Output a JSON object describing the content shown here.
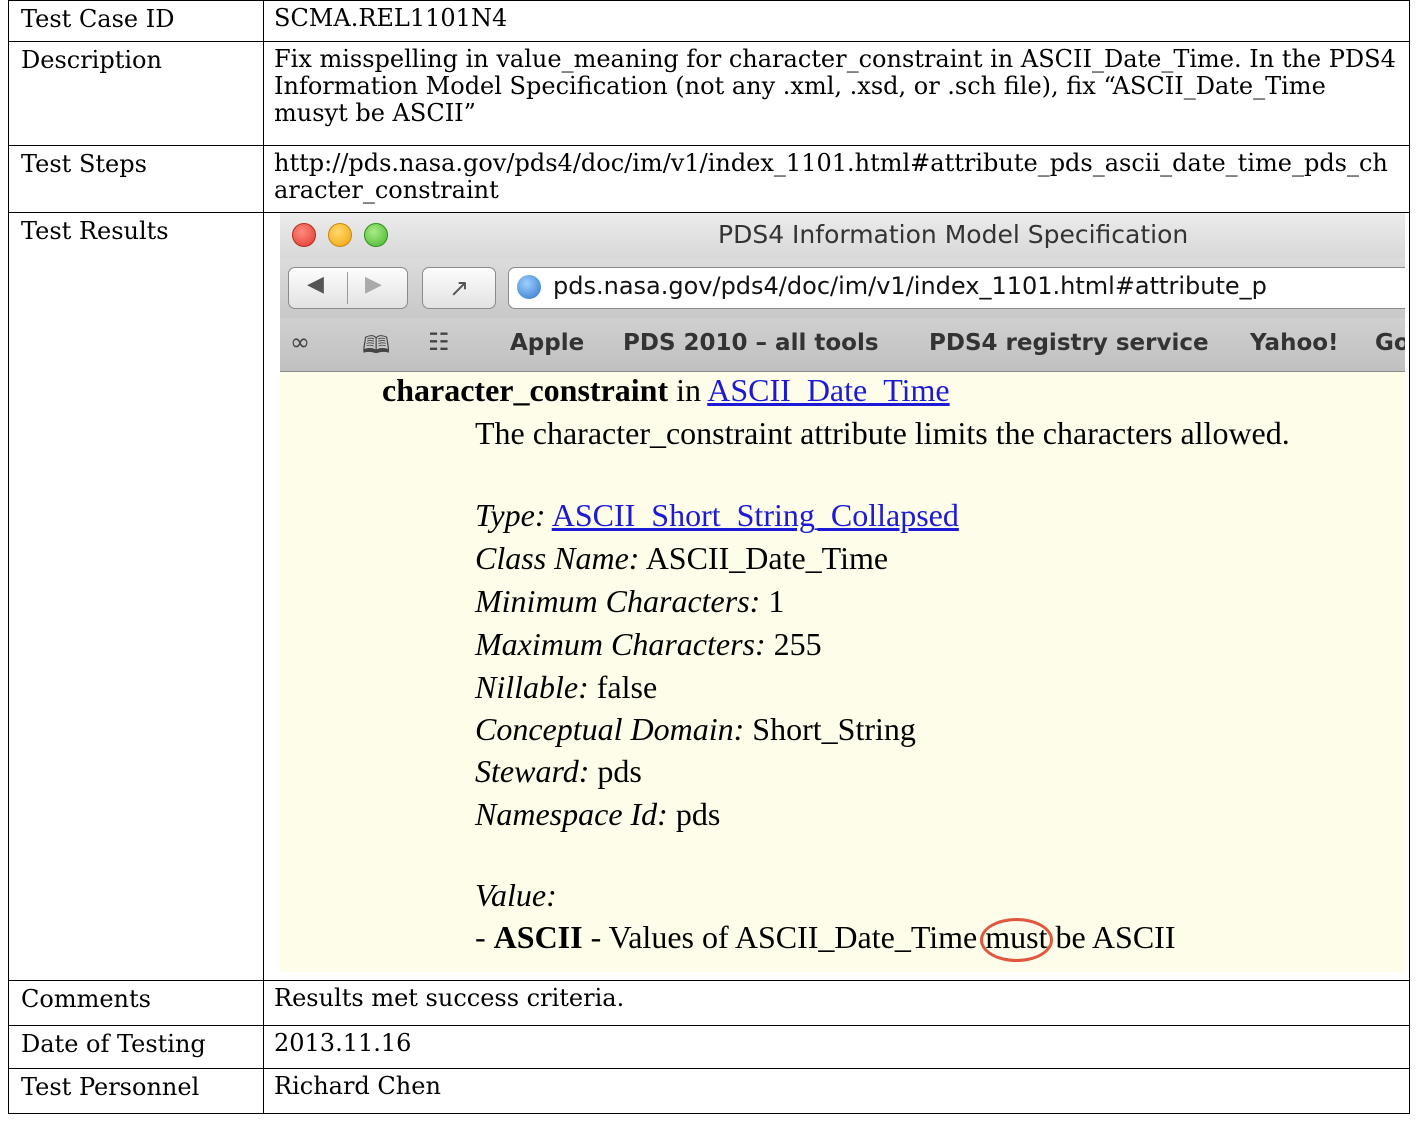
{
  "rows": {
    "test_case_id": {
      "label": "Test Case ID",
      "value": "SCMA.REL1101N4"
    },
    "description": {
      "label": "Description",
      "value": "Fix misspelling in value_meaning for character_constraint in ASCII_Date_Time. In the PDS4 Information Model Specification (not any .xml, .xsd, or .sch file), fix “ASCII_Date_Time musyt be ASCII”"
    },
    "test_steps": {
      "label": "Test Steps",
      "value": "http://pds.nasa.gov/pds4/doc/im/v1/index_1101.html#attribute_pds_ascii_date_time_pds_character_constraint"
    },
    "test_results": {
      "label": "Test Results"
    },
    "comments": {
      "label": "Comments",
      "value": "Results met success criteria."
    },
    "date_of_testing": {
      "label": "Date of Testing",
      "value": "2013.11.16"
    },
    "test_personnel": {
      "label": "Test Personnel",
      "value": "Richard Chen"
    }
  },
  "browser": {
    "window_title": "PDS4 Information Model Specification",
    "url": "pds.nasa.gov/pds4/doc/im/v1/index_1101.html#attribute_p",
    "nav_back": "◀",
    "nav_forward": "▶",
    "share_glyph": "↗",
    "bookmark_icons": {
      "reading_list": "∞",
      "bookmarks": "🕮",
      "top_sites": "☷"
    },
    "bookmarks": [
      "Apple",
      "PDS 2010 – all tools",
      "PDS4 registry service",
      "Yahoo!",
      "Go"
    ]
  },
  "page": {
    "attr_name": "character_constraint",
    "in_word": " in ",
    "class_link": "ASCII_Date_Time",
    "definition": "The character_constraint attribute limits the characters allowed.",
    "type_label": "Type:",
    "type_value": "ASCII_Short_String_Collapsed",
    "class_name_label": "Class Name:",
    "class_name_value": "ASCII_Date_Time",
    "min_chars_label": "Minimum Characters:",
    "min_chars_value": "1",
    "max_chars_label": "Maximum Characters:",
    "max_chars_value": "255",
    "nillable_label": "Nillable:",
    "nillable_value": "false",
    "domain_label": "Conceptual Domain:",
    "domain_value": "Short_String",
    "steward_label": "Steward:",
    "steward_value": "pds",
    "namespace_label": "Namespace Id:",
    "namespace_value": "pds",
    "value_label": "Value:",
    "value_dash": "- ",
    "value_key": "ASCII",
    "value_meaning_pre": " - Values of ASCII_Date_Time ",
    "value_meaning_highlight": "must",
    "value_meaning_post": " be ASCII"
  },
  "colors": {
    "highlight_circle": "#e0573f",
    "link": "#1c1ad6",
    "page_background": "#fdfde9"
  }
}
